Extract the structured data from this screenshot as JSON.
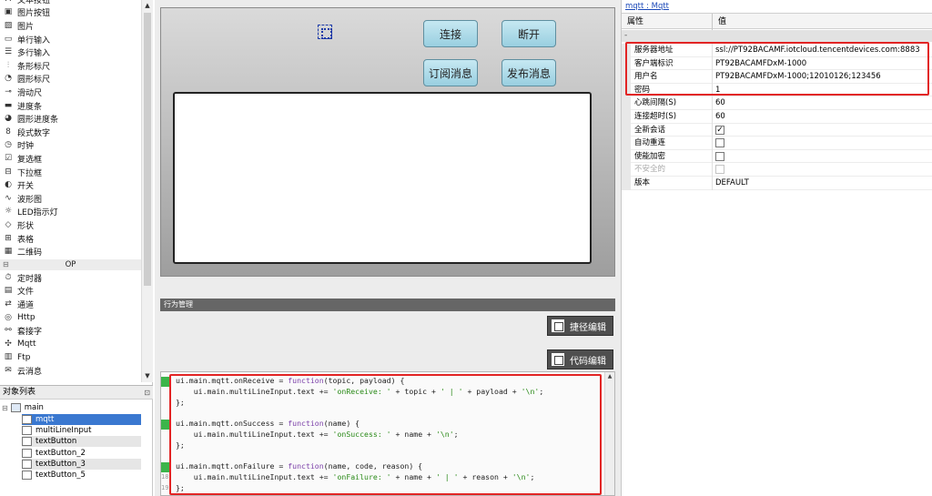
{
  "toolbox": {
    "items": [
      {
        "icon": "label-icon",
        "glyph": "A",
        "label": "文本按钮"
      },
      {
        "icon": "image-button-icon",
        "glyph": "▣",
        "label": "图片按钮"
      },
      {
        "icon": "image-icon",
        "glyph": "▨",
        "label": "图片"
      },
      {
        "icon": "single-line-input-icon",
        "glyph": "▭",
        "label": "单行输入"
      },
      {
        "icon": "multi-line-input-icon",
        "glyph": "☰",
        "label": "多行输入"
      },
      {
        "icon": "bar-gauge-icon",
        "glyph": "⫶",
        "label": "条形标尺"
      },
      {
        "icon": "round-gauge-icon",
        "glyph": "◔",
        "label": "圆形标尺"
      },
      {
        "icon": "slider-icon",
        "glyph": "⊸",
        "label": "滑动尺"
      },
      {
        "icon": "progress-bar-icon",
        "glyph": "▬",
        "label": "进度条"
      },
      {
        "icon": "round-progress-icon",
        "glyph": "◕",
        "label": "圆形进度条"
      },
      {
        "icon": "segment-digit-icon",
        "glyph": "8",
        "label": "段式数字"
      },
      {
        "icon": "clock-icon",
        "glyph": "◷",
        "label": "时钟"
      },
      {
        "icon": "checkbox-icon",
        "glyph": "☑",
        "label": "复选框"
      },
      {
        "icon": "dropdown-icon",
        "glyph": "⊟",
        "label": "下拉框"
      },
      {
        "icon": "switch-icon",
        "glyph": "◐",
        "label": "开关"
      },
      {
        "icon": "waveform-icon",
        "glyph": "∿",
        "label": "波形图"
      },
      {
        "icon": "led-icon",
        "glyph": "☼",
        "label": "LED指示灯"
      },
      {
        "icon": "shape-icon",
        "glyph": "◇",
        "label": "形状"
      },
      {
        "icon": "table-icon",
        "glyph": "⊞",
        "label": "表格"
      },
      {
        "icon": "qrcode-icon",
        "glyph": "▦",
        "label": "二维码"
      }
    ],
    "category": "OP",
    "category_collapse": "⊟",
    "op_items": [
      {
        "icon": "timer-icon",
        "glyph": "⏱",
        "label": "定时器"
      },
      {
        "icon": "file-icon",
        "glyph": "▤",
        "label": "文件"
      },
      {
        "icon": "channel-icon",
        "glyph": "⇄",
        "label": "通道"
      },
      {
        "icon": "http-icon",
        "glyph": "◎",
        "label": "Http"
      },
      {
        "icon": "socket-icon",
        "glyph": "⚯",
        "label": "套接字"
      },
      {
        "icon": "mqtt-icon",
        "glyph": "✣",
        "label": "Mqtt"
      },
      {
        "icon": "ftp-icon",
        "glyph": "▥",
        "label": "Ftp"
      },
      {
        "icon": "cloud-message-icon",
        "glyph": "✉",
        "label": "云消息"
      }
    ],
    "scroll_up": "▲",
    "scroll_down": "▼"
  },
  "object_list": {
    "title": "对象列表",
    "pin": "⊡",
    "expander": "⊟",
    "root": "main",
    "children": [
      "mqtt",
      "multiLineInput",
      "textButton",
      "textButton_2",
      "textButton_3",
      "textButton_5"
    ]
  },
  "canvas": {
    "buttons": {
      "connect": "连接",
      "disconnect": "断开",
      "subscribe": "订阅消息",
      "publish": "发布消息"
    }
  },
  "behavior": {
    "title": "行为管理",
    "shortcut_edit": "捷径编辑",
    "code_edit": "代码编辑"
  },
  "code": {
    "line_numbers": [
      "10",
      "11",
      "12",
      "13",
      "14",
      "15",
      "16",
      "17",
      "18",
      "19"
    ],
    "lines": [
      "ui.main.mqtt.onReceive = function(topic, payload) {",
      "    ui.main.multiLineInput.text += 'onReceive: ' + topic + ' | ' + payload + '\\n';",
      "};",
      "",
      "ui.main.mqtt.onSuccess = function(name) {",
      "    ui.main.multiLineInput.text += 'onSuccess: ' + name + '\\n';",
      "};",
      "",
      "ui.main.mqtt.onFailure = function(name, code, reason) {",
      "    ui.main.multiLineInput.text += 'onFailure: ' + name + ' | ' + reason + '\\n';",
      "};"
    ]
  },
  "props": {
    "link": "mqtt : Mqtt",
    "col_name": "属性",
    "col_value": "值",
    "group": "-",
    "rows": [
      {
        "name": "服务器地址",
        "value": "ssl://PT92BACAMF.iotcloud.tencentdevices.com:8883"
      },
      {
        "name": "客户端标识",
        "value": "PT92BACAMFDxM-1000"
      },
      {
        "name": "用户名",
        "value": "PT92BACAMFDxM-1000;12010126;123456"
      },
      {
        "name": "密码",
        "value": "1"
      },
      {
        "name": "心跳间隔(S)",
        "value": "60"
      },
      {
        "name": "连接超时(S)",
        "value": "60"
      },
      {
        "name": "全新会话",
        "checked": true,
        "check_mark": "✓"
      },
      {
        "name": "自动重连",
        "checked": false
      },
      {
        "name": "使能加密",
        "checked": false
      },
      {
        "name": "不安全的",
        "checked": false,
        "disabled": true
      },
      {
        "name": "版本",
        "value": "DEFAULT"
      }
    ]
  },
  "colors": {
    "highlight": "#e22424",
    "selected": "#3a78d0",
    "button": "#aedbe9"
  }
}
